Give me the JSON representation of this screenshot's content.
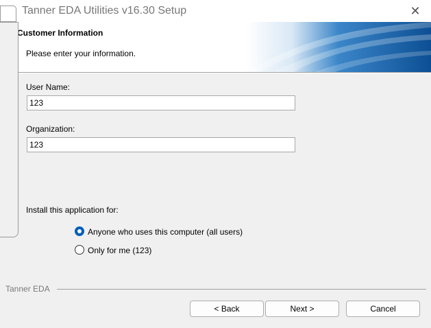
{
  "window": {
    "title": "Tanner EDA Utilities v16.30 Setup"
  },
  "header": {
    "title": "Customer Information",
    "subtitle": "Please enter your information."
  },
  "form": {
    "user_name": {
      "label": "User Name:",
      "value": "123"
    },
    "organization": {
      "label": "Organization:",
      "value": "123"
    },
    "install_for_label": "Install this application for:",
    "options": [
      {
        "label": "Anyone who uses this computer (all users)",
        "selected": true
      },
      {
        "label": "Only for me (123)",
        "selected": false
      }
    ]
  },
  "footer": {
    "brand": "Tanner EDA",
    "back_label": "< Back",
    "next_label": "Next >",
    "cancel_label": "Cancel"
  },
  "colors": {
    "accent": "#005fb8",
    "header_blue": "#1a6fb5"
  },
  "icons": {
    "close": "close-icon"
  }
}
